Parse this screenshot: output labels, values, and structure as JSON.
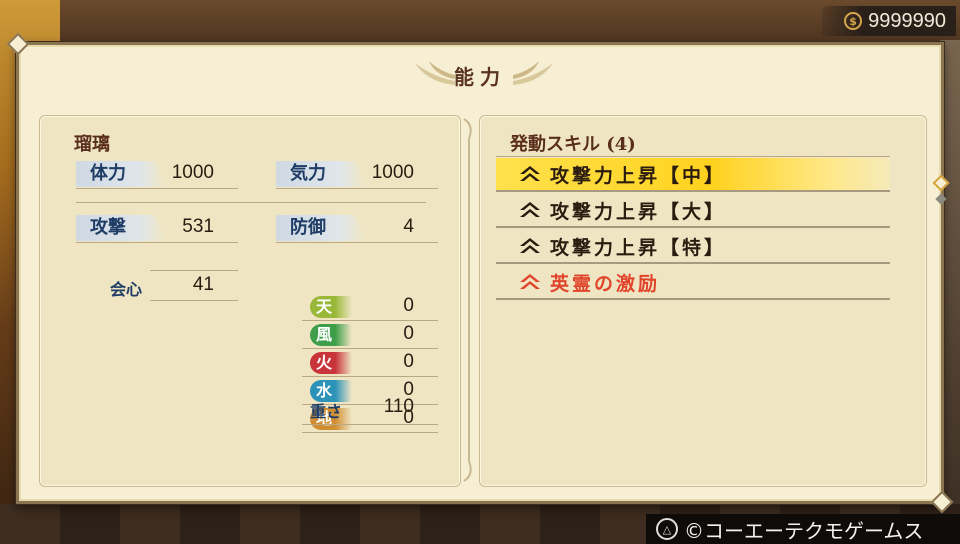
{
  "currency": {
    "amount": "9999990",
    "icon": "coin-icon"
  },
  "panel": {
    "title": "能力"
  },
  "character": {
    "name": "瑠璃",
    "stats": {
      "hp_label": "体力",
      "hp_value": "1000",
      "spirit_label": "気力",
      "spirit_value": "1000",
      "attack_label": "攻撃",
      "attack_value": "531",
      "defense_label": "防御",
      "defense_value": "4",
      "crit_label": "会心",
      "crit_value": "41",
      "weight_label": "重さ",
      "weight_value": "110"
    },
    "elements": [
      {
        "label": "天",
        "value": "0",
        "color": "#9ab838"
      },
      {
        "label": "風",
        "value": "0",
        "color": "#3e9e4a"
      },
      {
        "label": "火",
        "value": "0",
        "color": "#c8343a"
      },
      {
        "label": "水",
        "value": "0",
        "color": "#2b92b8"
      },
      {
        "label": "地",
        "value": "0",
        "color": "#d08e32"
      }
    ]
  },
  "skills": {
    "header": "発動スキル (4)",
    "items": [
      {
        "name": "攻撃力上昇【中】",
        "selected": true
      },
      {
        "name": "攻撃力上昇【大】",
        "selected": false
      },
      {
        "name": "攻撃力上昇【特】",
        "selected": false
      },
      {
        "name": "英霊の激励",
        "special": true
      }
    ]
  },
  "footer": {
    "copyright": "©コーエーテクモゲームス",
    "button_icon": "triangle-button-icon"
  },
  "colors": {
    "accent": "#ffd21e",
    "special": "#e0442a",
    "label_text": "#1e3c66"
  }
}
